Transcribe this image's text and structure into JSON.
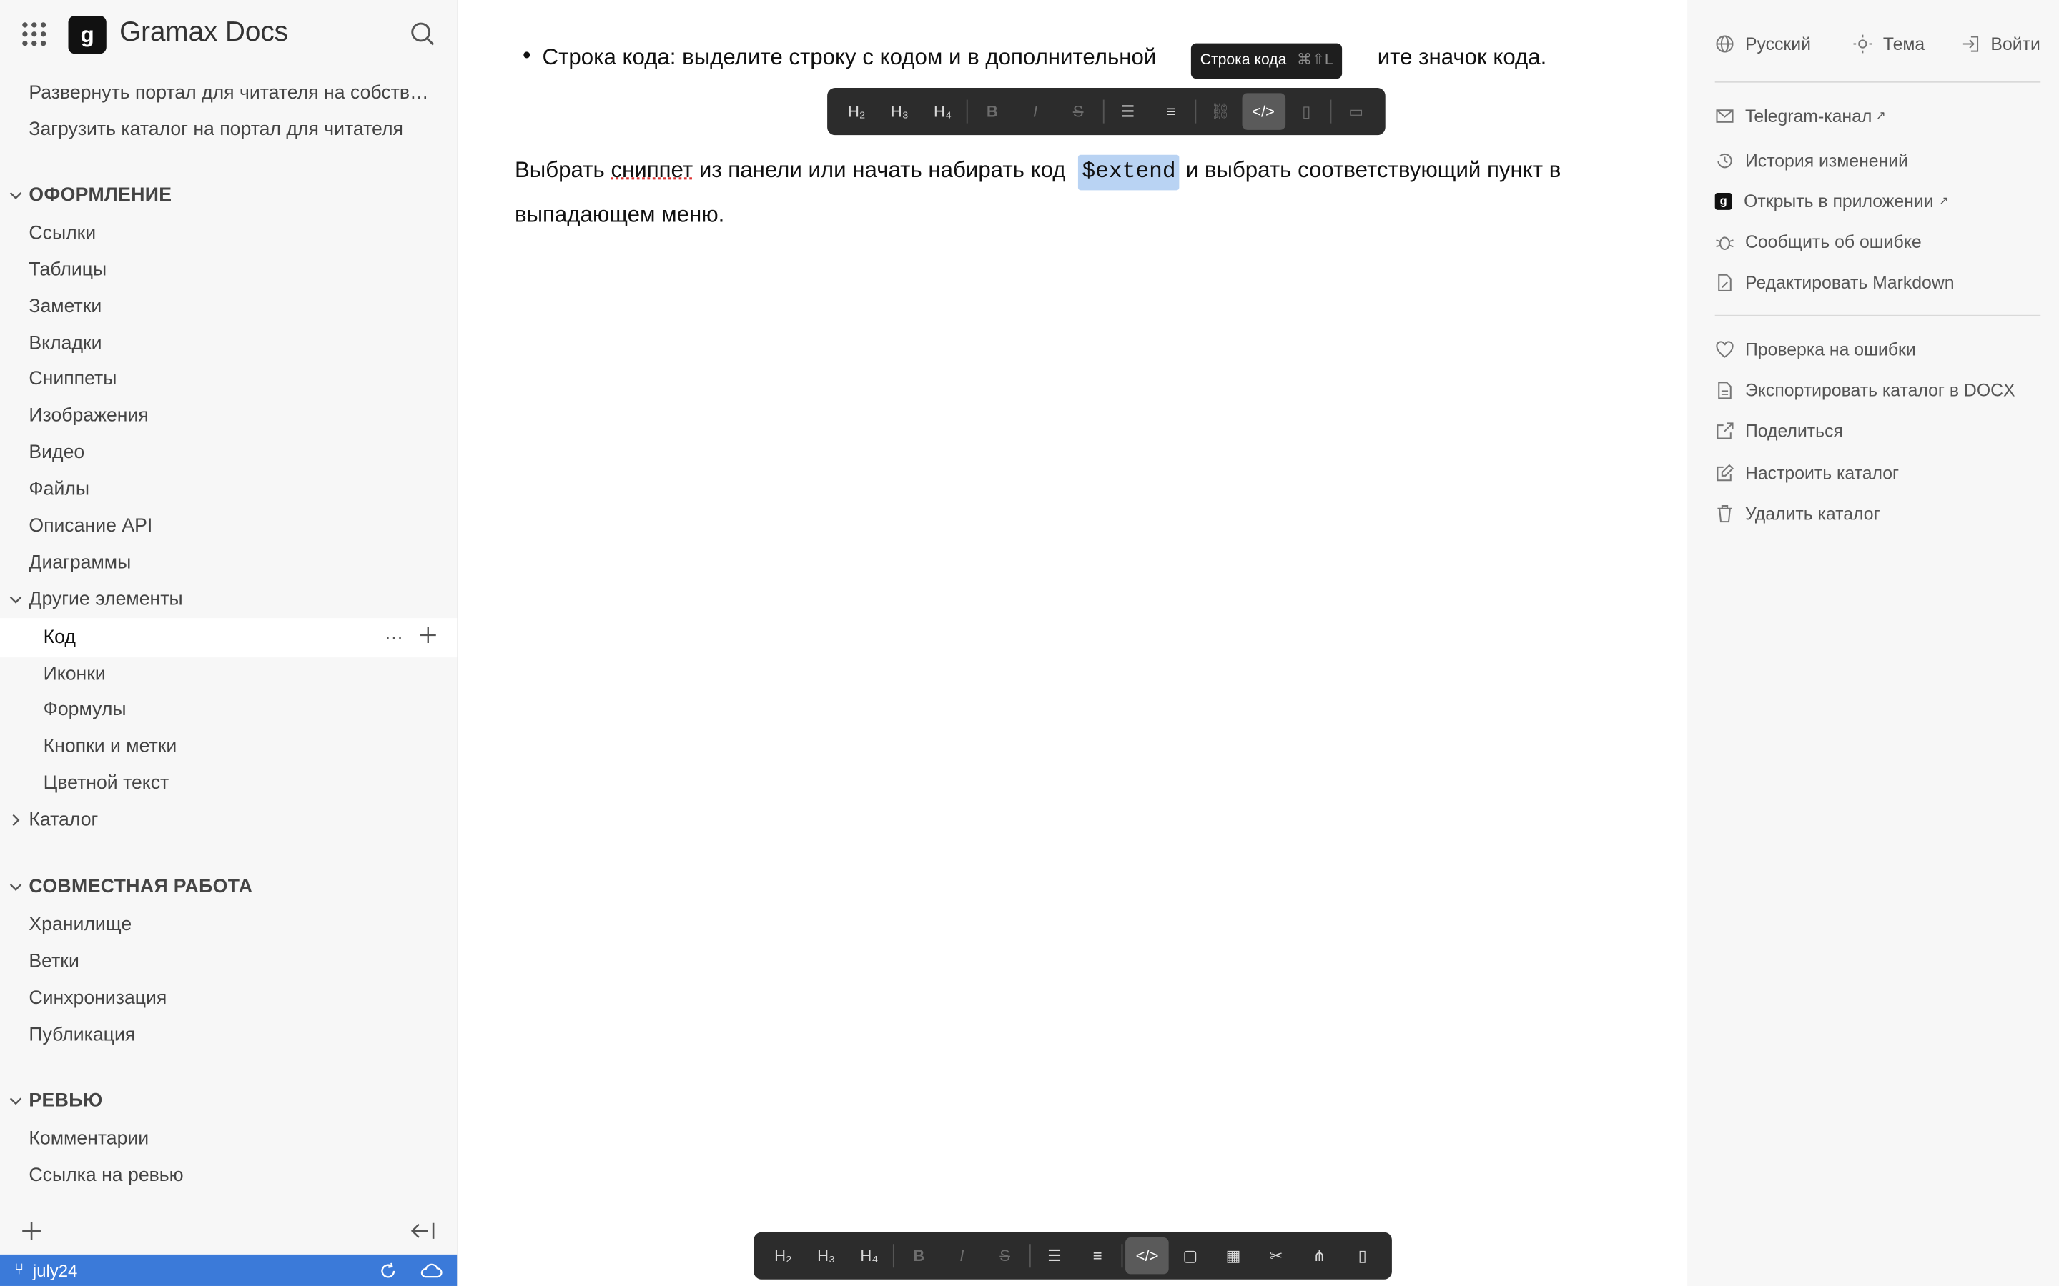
{
  "app": {
    "title": "Gramax Docs",
    "logo_letter": "g"
  },
  "sidebar": {
    "top_items": [
      "Развернуть портал для читателя на собств…",
      "Загрузить каталог на портал для читателя"
    ],
    "sections": [
      {
        "label": "ОФОРМЛЕНИЕ",
        "items": [
          "Ссылки",
          "Таблицы",
          "Заметки",
          "Вкладки",
          "Сниппеты",
          "Изображения",
          "Видео",
          "Файлы",
          "Описание API",
          "Диаграммы"
        ]
      },
      {
        "label": "Другие элементы",
        "items": [
          "Код",
          "Иконки",
          "Формулы",
          "Кнопки и метки",
          "Цветной текст"
        ]
      },
      {
        "label": "Каталог"
      },
      {
        "label": "СОВМЕСТНАЯ РАБОТА",
        "items": [
          "Хранилище",
          "Ветки",
          "Синхронизация",
          "Публикация"
        ]
      },
      {
        "label": "РЕВЬЮ",
        "items": [
          "Комментарии",
          "Ссылка на ревью"
        ]
      }
    ],
    "branch": "july24"
  },
  "content": {
    "bullet_text_a": "Строка кода: выделите строку с кодом и в дополнительной",
    "bullet_text_b": "ите значок кода.",
    "para_a": "Выбрать ",
    "para_snippet": "сниппет",
    "para_b": " из панели или начать набирать код ",
    "para_code": "$extend",
    "para_c": " и выбрать соответствующий пункт в",
    "para_d": "выпадающем меню."
  },
  "toolbar": {
    "h2": "H₂",
    "h3": "H₃",
    "h4": "H₄",
    "tooltip_label": "Строка кода",
    "tooltip_shortcut": "⌘⇧L"
  },
  "right_panel": {
    "language": "Русский",
    "theme": "Тема",
    "login": "Войти",
    "group1": [
      "Telegram-канал",
      "История изменений",
      "Открыть в приложении",
      "Сообщить об ошибке",
      "Редактировать Markdown"
    ],
    "group2": [
      "Проверка на ошибки",
      "Экспортировать каталог в DOCX",
      "Поделиться",
      "Настроить каталог",
      "Удалить каталог"
    ]
  }
}
